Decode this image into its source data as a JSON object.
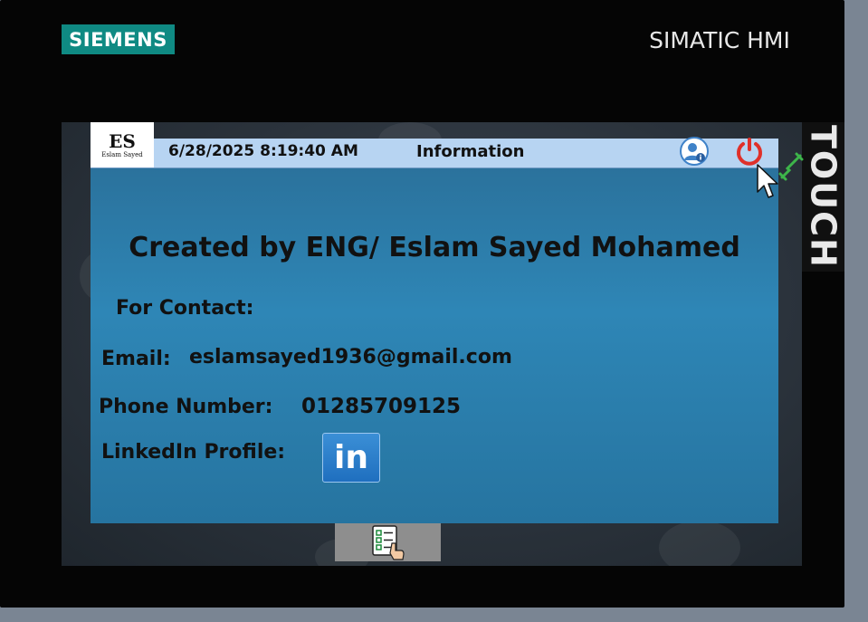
{
  "device": {
    "brand": "SIEMENS",
    "model_label": "SIMATIC HMI",
    "side_label": "TOUCH"
  },
  "header": {
    "logo_letters": "ES",
    "logo_subtitle": "Eslam Sayed",
    "datetime": "6/28/2025 8:19:40 AM",
    "title": "Information"
  },
  "content": {
    "creator": "Created by ENG/ Eslam Sayed Mohamed",
    "contact_heading": "For Contact:",
    "email_label": "Email:",
    "email_value": "eslamsayed1936@gmail.com",
    "phone_label": "Phone Number:",
    "phone_value": "01285709125",
    "linkedin_label": "LinkedIn Profile:",
    "linkedin_button": "in"
  },
  "icons": {
    "user": "user-info-icon",
    "power": "power-icon",
    "connection": "connection-status-icon",
    "cursor": "mouse-cursor-icon",
    "checklist": "checklist-hand-icon"
  },
  "colors": {
    "brand_teal": "#0f8a83",
    "header_bar": "#b7d4f2",
    "panel_blue": "#2e86b6",
    "power_red": "#e0302a",
    "linkedin_blue": "#1f6fbf"
  }
}
